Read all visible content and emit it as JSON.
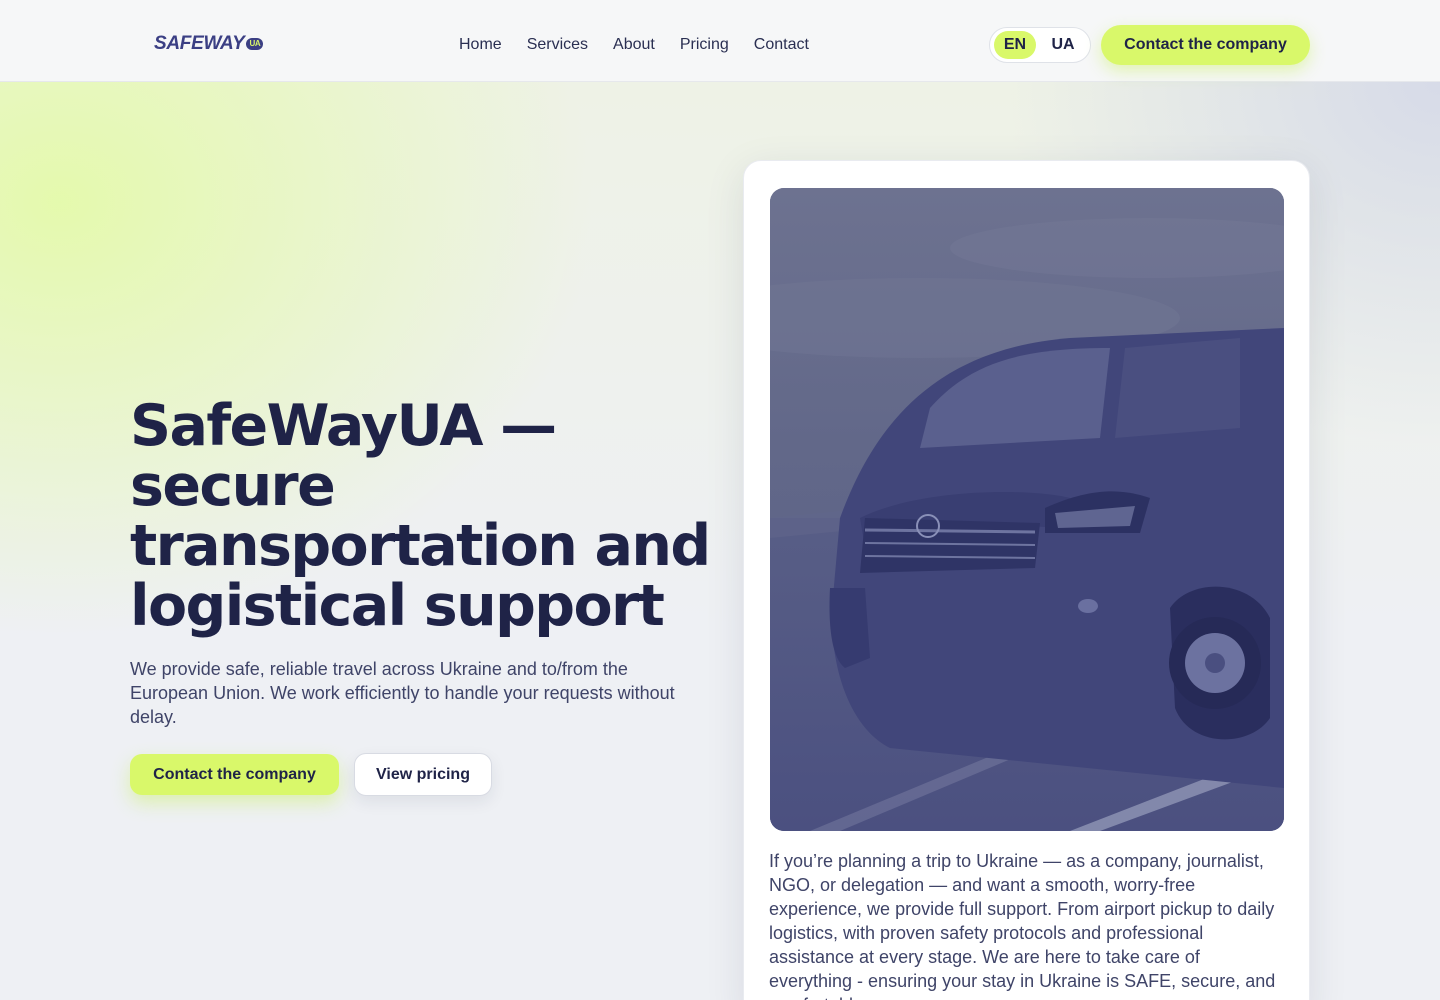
{
  "brand": {
    "name": "SAFEWAY",
    "badge": "UA"
  },
  "nav": {
    "items": [
      {
        "label": "Home"
      },
      {
        "label": "Services"
      },
      {
        "label": "About"
      },
      {
        "label": "Pricing"
      },
      {
        "label": "Contact"
      }
    ]
  },
  "language": {
    "options": [
      "EN",
      "UA"
    ],
    "selected": "EN"
  },
  "header": {
    "cta_label": "Contact the company"
  },
  "hero": {
    "title": "SafeWayUA — secure transportation and logistical support",
    "description": "We provide safe, reliable travel across Ukraine and to/from the European Union. We work efficiently to handle your requests without delay.",
    "primary_label": "Contact the company",
    "secondary_label": "View pricing"
  },
  "card": {
    "text": "If you’re planning a trip to Ukraine — as a company, journalist, NGO, or delegation — and want a smooth, worry-free experience, we provide full support. From airport pickup to daily logistics, with proven safety protocols and professional assistance at every stage. We are here to take care of everything - ensuring your stay in Ukraine is SAFE, secure, and comfortable."
  },
  "colors": {
    "accent": "#d9f86a",
    "text_dark": "#1f2347",
    "brand": "#3b3f84"
  }
}
